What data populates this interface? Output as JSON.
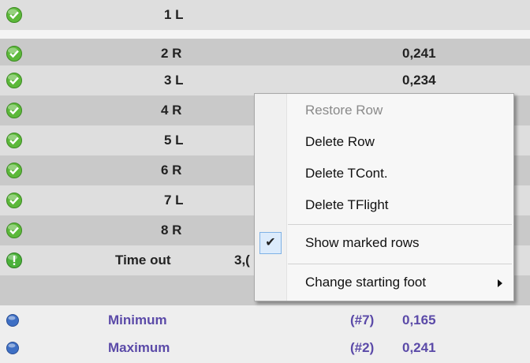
{
  "rows": [
    {
      "icon": "check-icon",
      "label": "1 L",
      "value": ""
    },
    {
      "icon": "check-icon",
      "label": "2 R",
      "value": "0,241"
    },
    {
      "icon": "check-icon",
      "label": "3 L",
      "value": "0,234"
    },
    {
      "icon": "check-icon",
      "label": "4 R",
      "value": ""
    },
    {
      "icon": "check-icon",
      "label": "5 L",
      "value": ""
    },
    {
      "icon": "check-icon",
      "label": "6 R",
      "value": ""
    },
    {
      "icon": "check-icon",
      "label": "7 L",
      "value": ""
    },
    {
      "icon": "check-icon",
      "label": "8 R",
      "value": ""
    },
    {
      "icon": "warning-icon",
      "label": "Time out",
      "value": "3,("
    }
  ],
  "stats": [
    {
      "label": "Minimum",
      "index": "(#7)",
      "value": "0,165"
    },
    {
      "label": "Maximum",
      "index": "(#2)",
      "value": "0,241"
    }
  ],
  "context_menu": {
    "items": [
      {
        "label": "Restore Row",
        "disabled": true
      },
      {
        "label": "Delete Row"
      },
      {
        "label": "Delete TCont."
      },
      {
        "label": "Delete TFlight"
      },
      {
        "label": "Show marked rows",
        "checked": true
      },
      {
        "label": "Change starting foot",
        "has_submenu": true
      }
    ]
  },
  "colors": {
    "check": "#5cb83a",
    "warning": "#4bb13a",
    "stat_dot": "#3e6fc4",
    "stat_text": "#5b4aa8"
  }
}
